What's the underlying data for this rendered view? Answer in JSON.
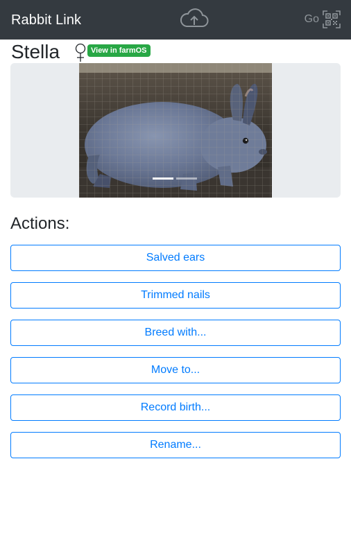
{
  "navbar": {
    "brand": "Rabbit Link",
    "sync_icon": "cloud-upload-icon",
    "go_label": "Go",
    "scan_icon": "qr-code-icon"
  },
  "rabbit": {
    "name": "Stella",
    "sex_icon": "female-symbol-icon",
    "farmos_link": "View in farmOS"
  },
  "carousel": {
    "active_index": 0,
    "slide_count": 2
  },
  "actions": {
    "heading": "Actions:",
    "buttons": [
      "Salved ears",
      "Trimmed nails",
      "Breed with...",
      "Move to...",
      "Record birth...",
      "Rename..."
    ]
  },
  "colors": {
    "navbar_bg": "#343a40",
    "primary": "#007bff",
    "success_badge": "#28a745"
  }
}
